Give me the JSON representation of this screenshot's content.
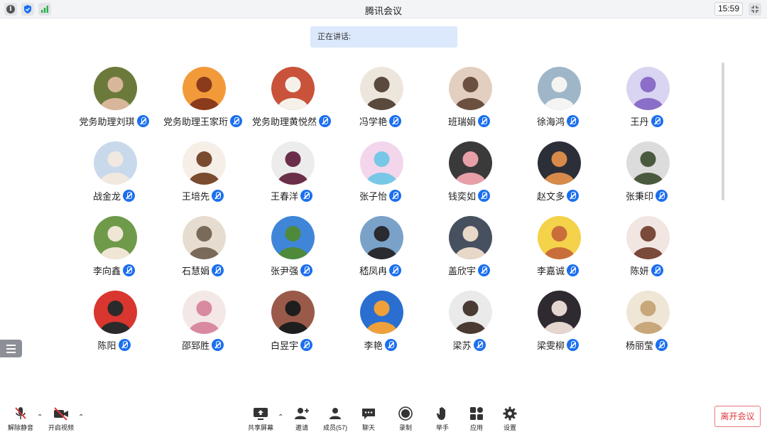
{
  "window": {
    "title": "腾讯会议",
    "clock": "15:59"
  },
  "status_icons": [
    "info-icon",
    "shield-icon",
    "signal-icon"
  ],
  "speaking_label": "正在讲话:",
  "colors": {
    "accent": "#1a6ff0",
    "danger": "#e0383e",
    "speaking_bg": "#dce8fb"
  },
  "participants": [
    {
      "name": "党务助理刘琪",
      "avatar": [
        "#6b7a3a",
        "#d8b69a"
      ]
    },
    {
      "name": "党务助理王家珩",
      "avatar": [
        "#f29a3a",
        "#8a3b1c"
      ]
    },
    {
      "name": "党务助理黄悦然",
      "avatar": [
        "#c9523a",
        "#f5f1ea"
      ]
    },
    {
      "name": "冯学艳",
      "avatar": [
        "#ece6dd",
        "#5a4a3e"
      ]
    },
    {
      "name": "班瑞娟",
      "avatar": [
        "#e3cfbf",
        "#6b5040"
      ]
    },
    {
      "name": "徐海鸿",
      "avatar": [
        "#9fb6c9",
        "#f4f4f2"
      ]
    },
    {
      "name": "王丹",
      "avatar": [
        "#d9d4f2",
        "#8a6ec7"
      ]
    },
    {
      "name": "战金龙",
      "avatar": [
        "#c9d9ec",
        "#f1e9e0"
      ]
    },
    {
      "name": "王培先",
      "avatar": [
        "#f6efe7",
        "#7a4b2e"
      ]
    },
    {
      "name": "王春洋",
      "avatar": [
        "#ececec",
        "#6a2e4a"
      ]
    },
    {
      "name": "张子怡",
      "avatar": [
        "#f3d6ec",
        "#78c7e6"
      ]
    },
    {
      "name": "钱奕如",
      "avatar": [
        "#3a3a3a",
        "#e8a0a8"
      ]
    },
    {
      "name": "赵文多",
      "avatar": [
        "#2d2f38",
        "#d88a4a"
      ]
    },
    {
      "name": "张秉印",
      "avatar": [
        "#dcdcdc",
        "#4a5a3e"
      ]
    },
    {
      "name": "李向鑫",
      "avatar": [
        "#6e9a4a",
        "#f0e6d6"
      ]
    },
    {
      "name": "石慧娟",
      "avatar": [
        "#e6ddd0",
        "#7a6a5a"
      ]
    },
    {
      "name": "张尹强",
      "avatar": [
        "#3f86d8",
        "#4f8a3a"
      ]
    },
    {
      "name": "嵇凤冉",
      "avatar": [
        "#7aa2c9",
        "#2a2a30"
      ]
    },
    {
      "name": "盖欣宇",
      "avatar": [
        "#46505e",
        "#e8d8c8"
      ]
    },
    {
      "name": "李嘉诚",
      "avatar": [
        "#f4d24a",
        "#c96e3a"
      ]
    },
    {
      "name": "陈妍",
      "avatar": [
        "#f2e6e2",
        "#7a4a3a"
      ]
    },
    {
      "name": "陈阳",
      "avatar": [
        "#d8362e",
        "#2a2a2a"
      ]
    },
    {
      "name": "邵郅胜",
      "avatar": [
        "#f4e8e6",
        "#d88aa0"
      ]
    },
    {
      "name": "白昱宇",
      "avatar": [
        "#9a5a4a",
        "#1e1e1e"
      ]
    },
    {
      "name": "李艳",
      "avatar": [
        "#2a6fd0",
        "#f0a03a"
      ]
    },
    {
      "name": "梁苏",
      "avatar": [
        "#eaeaea",
        "#4a3a34"
      ]
    },
    {
      "name": "梁雯柳",
      "avatar": [
        "#2e2a30",
        "#e6d6d0"
      ]
    },
    {
      "name": "杨丽莹",
      "avatar": [
        "#efe6d6",
        "#c8a77a"
      ]
    }
  ],
  "toolbar": {
    "unmute": "解除静音",
    "start_video": "开启视频",
    "share_screen": "共享屏幕",
    "invite": "邀请",
    "members": "成员(57)",
    "chat": "聊天",
    "record": "录制",
    "raise_hand": "举手",
    "apps": "应用",
    "settings": "设置",
    "leave": "离开会议"
  }
}
